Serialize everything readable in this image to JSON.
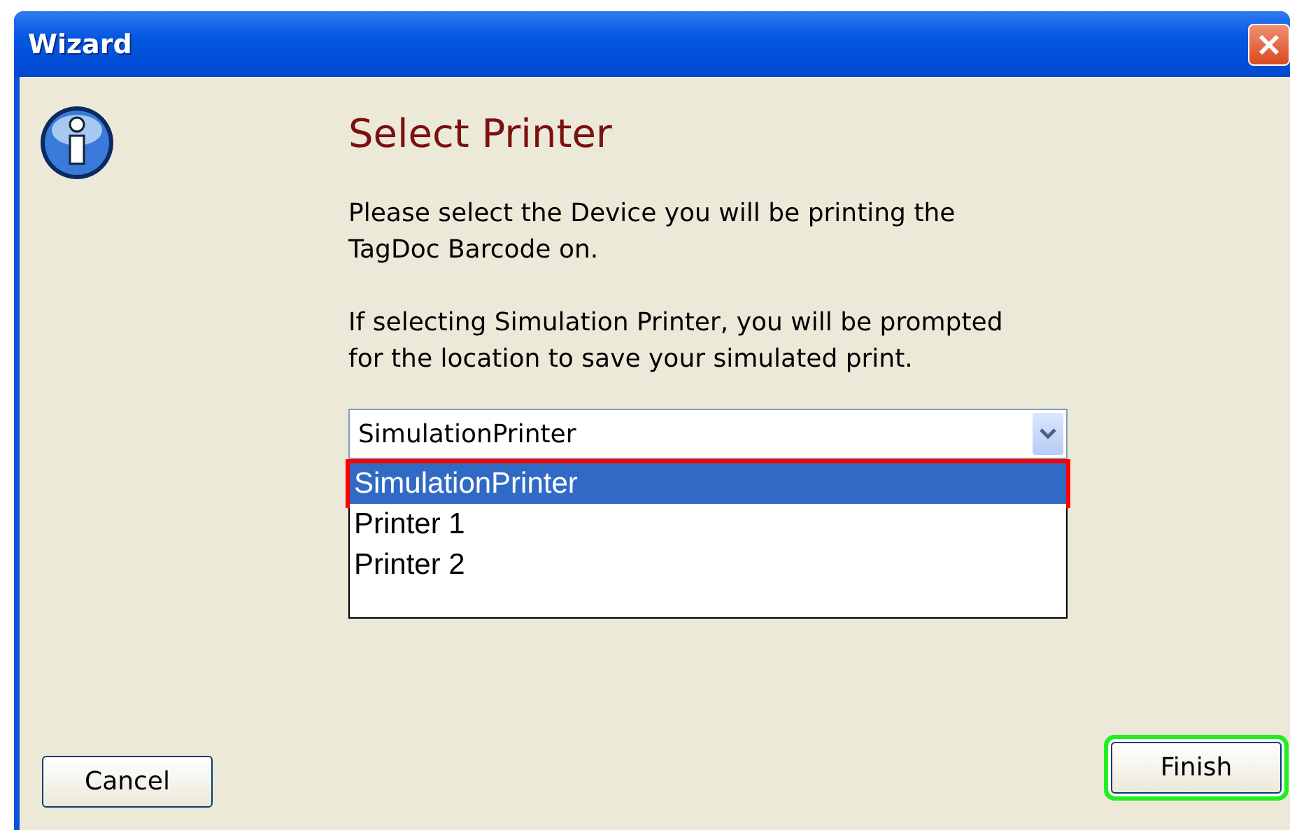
{
  "window": {
    "title": "Wizard"
  },
  "heading": "Select Printer",
  "paragraphs": [
    "Please select the Device you will be printing the TagDoc Barcode on.",
    "If selecting Simulation Printer, you will be prompted for the location to save your simulated print."
  ],
  "printer_select": {
    "value": "SimulationPrinter",
    "expanded": true,
    "options": [
      {
        "label": "SimulationPrinter",
        "selected": true,
        "highlighted": true
      },
      {
        "label": "Printer 1",
        "selected": false,
        "highlighted": false
      },
      {
        "label": "Printer 2",
        "selected": false,
        "highlighted": false
      }
    ]
  },
  "buttons": [
    {
      "label": "Cancel",
      "kind": "cancel",
      "highlighted": false
    },
    {
      "label": "Finish",
      "kind": "finish",
      "highlighted": true
    }
  ]
}
